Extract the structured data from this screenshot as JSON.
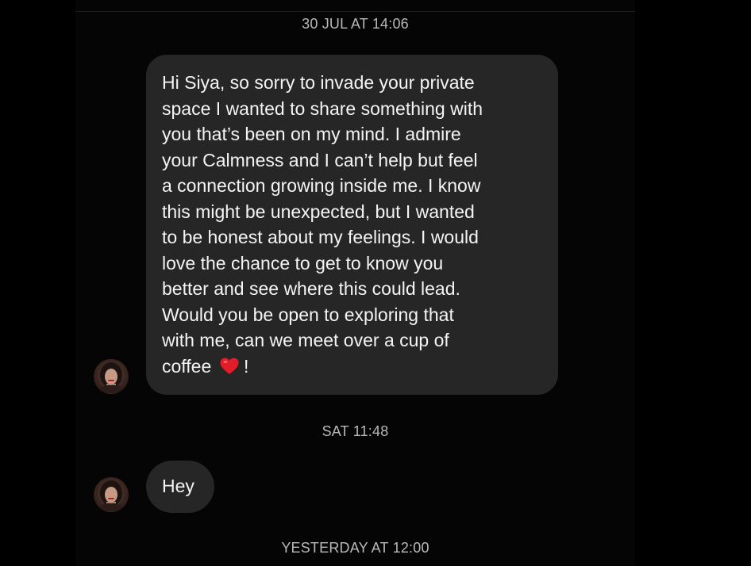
{
  "thread": {
    "timestamps": {
      "first": "30 JUL AT 14:06",
      "second": "SAT 11:48",
      "third": "YESTERDAY AT 12:00"
    },
    "messages": [
      {
        "lines": [
          "Hi Siya, so sorry to invade your private",
          "space I wanted to share something with",
          "you that’s been on my mind. I admire",
          "your Calmness and I can’t help but feel",
          "a connection growing inside me. I know",
          "this might be unexpected, but I wanted",
          "to be honest about my feelings. I would",
          "love the chance to get to know you",
          "better and see where this could lead.",
          "Would you be open to exploring that",
          "with me, can we meet over a cup of"
        ],
        "last_line_start": "coffee",
        "emoji": "heart-icon",
        "last_line_end": "!"
      },
      {
        "text": "Hey"
      }
    ]
  },
  "colors": {
    "background": "#000000",
    "bubble": "#262626",
    "text": "#f4f4f4",
    "timestamp": "#b9b9b9",
    "heart": "#e11d2a"
  }
}
